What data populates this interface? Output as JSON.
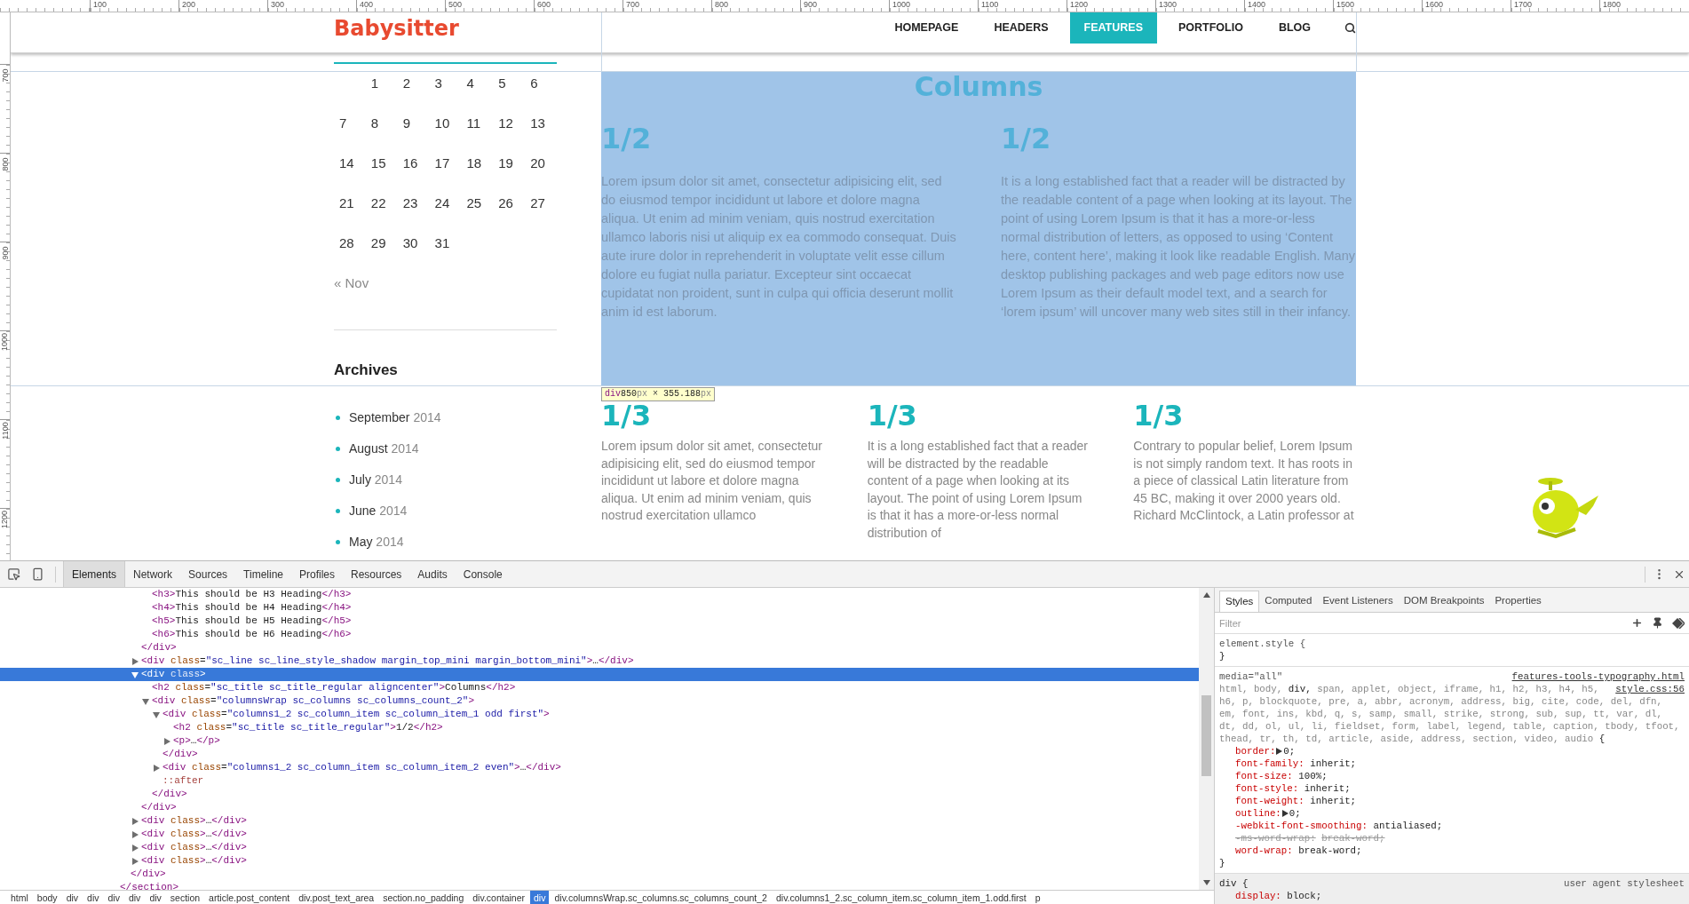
{
  "ruler": {
    "top_labels": [
      "100",
      "200",
      "300",
      "400",
      "500",
      "600",
      "700",
      "800",
      "900",
      "1000",
      "1100",
      "1200",
      "1300",
      "1400",
      "1500",
      "1600",
      "1700",
      "1800"
    ],
    "side_labels": [
      "700",
      "800",
      "900",
      "1000",
      "1100",
      "1200"
    ]
  },
  "header": {
    "logo": "Babysitter",
    "nav": [
      {
        "label": "HOMEPAGE",
        "selected": false
      },
      {
        "label": "HEADERS",
        "selected": false
      },
      {
        "label": "FEATURES",
        "selected": true
      },
      {
        "label": "PORTFOLIO",
        "selected": false
      },
      {
        "label": "BLOG",
        "selected": false
      }
    ]
  },
  "sidebar": {
    "calendar": {
      "weeks": [
        [
          "1",
          "2",
          "3",
          "4",
          "5",
          "6"
        ],
        [
          "7",
          "8",
          "9",
          "10",
          "11",
          "12",
          "13"
        ],
        [
          "14",
          "15",
          "16",
          "17",
          "18",
          "19",
          "20"
        ],
        [
          "21",
          "22",
          "23",
          "24",
          "25",
          "26",
          "27"
        ],
        [
          "28",
          "29",
          "30",
          "31"
        ]
      ],
      "prev_link": "« Nov"
    },
    "archives": {
      "title": "Archives",
      "items": [
        {
          "month": "September",
          "year": "2014"
        },
        {
          "month": "August",
          "year": "2014"
        },
        {
          "month": "July",
          "year": "2014"
        },
        {
          "month": "June",
          "year": "2014"
        },
        {
          "month": "May",
          "year": "2014"
        }
      ]
    }
  },
  "columns_block": {
    "title": "Columns",
    "highlighted": true,
    "columns": [
      {
        "heading": "1/2",
        "text": "Lorem ipsum dolor sit amet, consectetur adipisicing elit, sed do eiusmod tempor incididunt ut labore et dolore magna aliqua. Ut enim ad minim veniam, quis nostrud exercitation ullamco laboris nisi ut aliquip ex ea commodo consequat. Duis aute irure dolor in reprehenderit in voluptate velit esse cillum dolore eu fugiat nulla pariatur. Excepteur sint occaecat cupidatat non proident, sunt in culpa qui officia deserunt mollit anim id est laborum."
      },
      {
        "heading": "1/2",
        "text": "It is a long established fact that a reader will be distracted by the readable content of a page when looking at its layout. The point of using Lorem Ipsum is that it has a more-or-less normal distribution of letters, as opposed to using ‘Content here, content here’, making it look like readable English. Many desktop publishing packages and web page editors now use Lorem Ipsum as their default model text, and a search for ‘lorem ipsum’ will uncover many web sites still in their infancy."
      }
    ]
  },
  "size_tooltip": {
    "parts": [
      {
        "kind": "tag",
        "text": "div"
      },
      {
        "kind": "number",
        "text": "850"
      },
      {
        "kind": "unit",
        "text": "px"
      },
      {
        "kind": "text",
        "text": " × "
      },
      {
        "kind": "number",
        "text": "355.188"
      },
      {
        "kind": "unit",
        "text": "px"
      }
    ]
  },
  "thirds_block": {
    "columns": [
      {
        "heading": "1/3",
        "text": "Lorem ipsum dolor sit amet, consectetur adipisicing elit, sed do eiusmod tempor incididunt ut labore et dolore magna aliqua. Ut enim ad minim veniam, quis nostrud exercitation ullamco"
      },
      {
        "heading": "1/3",
        "text": "It is a long established fact that a reader will be distracted by the readable content of a page when looking at its layout. The point of using Lorem Ipsum is that it has a more-or-less normal distribution of"
      },
      {
        "heading": "1/3",
        "text": "Contrary to popular belief, Lorem Ipsum is not simply random text. It has roots in a piece of classical Latin literature from 45 BC, making it over 2000 years old. Richard McClintock, a Latin professor at"
      }
    ]
  },
  "devtools": {
    "tabs": [
      {
        "label": "Elements",
        "selected": true
      },
      {
        "label": "Network",
        "selected": false
      },
      {
        "label": "Sources",
        "selected": false
      },
      {
        "label": "Timeline",
        "selected": false
      },
      {
        "label": "Profiles",
        "selected": false
      },
      {
        "label": "Resources",
        "selected": false
      },
      {
        "label": "Audits",
        "selected": false
      },
      {
        "label": "Console",
        "selected": false
      }
    ],
    "tree": [
      {
        "selected": false,
        "close": [
          {
            "kind": "tag",
            "text": "</section>"
          }
        ],
        "children": [
          {
            "selected": false,
            "close": [
              {
                "kind": "tag",
                "text": "</div>"
              }
            ],
            "children": [
              {
                "selected": false,
                "close": [
                  {
                    "kind": "tag",
                    "text": "</div>"
                  }
                ],
                "children": [
                  {
                    "selected": false,
                    "open": [
                      {
                        "kind": "tag",
                        "text": "<h3>"
                      },
                      {
                        "kind": "text",
                        "text": "This should be H3 Heading"
                      },
                      {
                        "kind": "tag",
                        "text": "</h3>"
                      }
                    ]
                  },
                  {
                    "selected": false,
                    "open": [
                      {
                        "kind": "tag",
                        "text": "<h4>"
                      },
                      {
                        "kind": "text",
                        "text": "This should be H4 Heading"
                      },
                      {
                        "kind": "tag",
                        "text": "</h4>"
                      }
                    ]
                  },
                  {
                    "selected": false,
                    "open": [
                      {
                        "kind": "tag",
                        "text": "<h5>"
                      },
                      {
                        "kind": "text",
                        "text": "This should be H5 Heading"
                      },
                      {
                        "kind": "tag",
                        "text": "</h5>"
                      }
                    ]
                  },
                  {
                    "selected": false,
                    "open": [
                      {
                        "kind": "tag",
                        "text": "<h6>"
                      },
                      {
                        "kind": "text",
                        "text": "This should be H6 Heading"
                      },
                      {
                        "kind": "tag",
                        "text": "</h6>"
                      }
                    ]
                  }
                ]
              },
              {
                "selected": false,
                "expanded": false,
                "open": [
                  {
                    "kind": "tag",
                    "text": "<div"
                  },
                  {
                    "kind": "attr",
                    "text": " class"
                  },
                  {
                    "kind": "text",
                    "text": "="
                  },
                  {
                    "kind": "value",
                    "text": "\"sc_line sc_line_style_shadow margin_top_mini margin_bottom_mini\""
                  },
                  {
                    "kind": "tag",
                    "text": ">"
                  },
                  {
                    "kind": "text",
                    "text": "…"
                  },
                  {
                    "kind": "tag",
                    "text": "</div>"
                  }
                ]
              },
              {
                "selected": true,
                "expanded": true,
                "open": [
                  {
                    "kind": "tag",
                    "text": "<div"
                  },
                  {
                    "kind": "attr",
                    "text": " class"
                  },
                  {
                    "kind": "tag",
                    "text": ">"
                  }
                ],
                "close": [
                  {
                    "kind": "tag",
                    "text": "</div>"
                  }
                ],
                "children": [
                  {
                    "selected": false,
                    "open": [
                      {
                        "kind": "tag",
                        "text": "<h2"
                      },
                      {
                        "kind": "attr",
                        "text": " class"
                      },
                      {
                        "kind": "text",
                        "text": "="
                      },
                      {
                        "kind": "value",
                        "text": "\"sc_title sc_title_regular aligncenter\""
                      },
                      {
                        "kind": "tag",
                        "text": ">"
                      },
                      {
                        "kind": "text",
                        "text": "Columns"
                      },
                      {
                        "kind": "tag",
                        "text": "</h2>"
                      }
                    ]
                  },
                  {
                    "selected": false,
                    "expanded": true,
                    "open": [
                      {
                        "kind": "tag",
                        "text": "<div"
                      },
                      {
                        "kind": "attr",
                        "text": " class"
                      },
                      {
                        "kind": "text",
                        "text": "="
                      },
                      {
                        "kind": "value",
                        "text": "\"columnsWrap sc_columns sc_columns_count_2\""
                      },
                      {
                        "kind": "tag",
                        "text": ">"
                      }
                    ],
                    "close": [
                      {
                        "kind": "tag",
                        "text": "</div>"
                      }
                    ],
                    "children": [
                      {
                        "selected": false,
                        "expanded": true,
                        "open": [
                          {
                            "kind": "tag",
                            "text": "<div"
                          },
                          {
                            "kind": "attr",
                            "text": " class"
                          },
                          {
                            "kind": "text",
                            "text": "="
                          },
                          {
                            "kind": "value",
                            "text": "\"columns1_2 sc_column_item sc_column_item_1 odd first\""
                          },
                          {
                            "kind": "tag",
                            "text": ">"
                          }
                        ],
                        "close": [
                          {
                            "kind": "tag",
                            "text": "</div>"
                          }
                        ],
                        "children": [
                          {
                            "selected": false,
                            "open": [
                              {
                                "kind": "tag",
                                "text": "<h2"
                              },
                              {
                                "kind": "attr",
                                "text": " class"
                              },
                              {
                                "kind": "text",
                                "text": "="
                              },
                              {
                                "kind": "value",
                                "text": "\"sc_title sc_title_regular\""
                              },
                              {
                                "kind": "tag",
                                "text": ">"
                              },
                              {
                                "kind": "text",
                                "text": "1/2"
                              },
                              {
                                "kind": "tag",
                                "text": "</h2>"
                              }
                            ]
                          },
                          {
                            "selected": false,
                            "expanded": false,
                            "open": [
                              {
                                "kind": "tag",
                                "text": "<p>"
                              },
                              {
                                "kind": "text",
                                "text": "…"
                              },
                              {
                                "kind": "tag",
                                "text": "</p>"
                              }
                            ]
                          }
                        ]
                      },
                      {
                        "selected": false,
                        "expanded": false,
                        "open": [
                          {
                            "kind": "tag",
                            "text": "<div"
                          },
                          {
                            "kind": "attr",
                            "text": " class"
                          },
                          {
                            "kind": "text",
                            "text": "="
                          },
                          {
                            "kind": "value",
                            "text": "\"columns1_2 sc_column_item sc_column_item_2 even\""
                          },
                          {
                            "kind": "tag",
                            "text": ">"
                          },
                          {
                            "kind": "text",
                            "text": "…"
                          },
                          {
                            "kind": "tag",
                            "text": "</div>"
                          }
                        ]
                      },
                      {
                        "selected": false,
                        "open": [
                          {
                            "kind": "pseudo",
                            "text": "::after"
                          }
                        ]
                      }
                    ]
                  }
                ]
              },
              {
                "selected": false,
                "expanded": false,
                "open": [
                  {
                    "kind": "tag",
                    "text": "<div"
                  },
                  {
                    "kind": "attr",
                    "text": " class"
                  },
                  {
                    "kind": "tag",
                    "text": ">"
                  },
                  {
                    "kind": "text",
                    "text": "…"
                  },
                  {
                    "kind": "tag",
                    "text": "</div>"
                  }
                ]
              },
              {
                "selected": false,
                "expanded": false,
                "open": [
                  {
                    "kind": "tag",
                    "text": "<div"
                  },
                  {
                    "kind": "attr",
                    "text": " class"
                  },
                  {
                    "kind": "tag",
                    "text": ">"
                  },
                  {
                    "kind": "text",
                    "text": "…"
                  },
                  {
                    "kind": "tag",
                    "text": "</div>"
                  }
                ]
              },
              {
                "selected": false,
                "expanded": false,
                "open": [
                  {
                    "kind": "tag",
                    "text": "<div"
                  },
                  {
                    "kind": "attr",
                    "text": " class"
                  },
                  {
                    "kind": "tag",
                    "text": ">"
                  },
                  {
                    "kind": "text",
                    "text": "…"
                  },
                  {
                    "kind": "tag",
                    "text": "</div>"
                  }
                ]
              },
              {
                "selected": false,
                "expanded": false,
                "open": [
                  {
                    "kind": "tag",
                    "text": "<div"
                  },
                  {
                    "kind": "attr",
                    "text": " class"
                  },
                  {
                    "kind": "tag",
                    "text": ">"
                  },
                  {
                    "kind": "text",
                    "text": "…"
                  },
                  {
                    "kind": "tag",
                    "text": "</div>"
                  }
                ]
              }
            ]
          }
        ]
      }
    ],
    "breadcrumbs": [
      {
        "label": "html",
        "selected": false
      },
      {
        "label": "body",
        "selected": false
      },
      {
        "label": "div",
        "selected": false
      },
      {
        "label": "div",
        "selected": false
      },
      {
        "label": "div",
        "selected": false
      },
      {
        "label": "div",
        "selected": false
      },
      {
        "label": "div",
        "selected": false
      },
      {
        "label": "section",
        "selected": false
      },
      {
        "label": "article.post_content",
        "selected": false
      },
      {
        "label": "div.post_text_area",
        "selected": false
      },
      {
        "label": "section.no_padding",
        "selected": false
      },
      {
        "label": "div.container",
        "selected": false
      },
      {
        "label": "div",
        "selected": true
      },
      {
        "label": "div.columnsWrap.sc_columns.sc_columns_count_2",
        "selected": false
      },
      {
        "label": "div.columns1_2.sc_column_item.sc_column_item_1.odd.first",
        "selected": false
      },
      {
        "label": "p",
        "selected": false
      }
    ],
    "styles": {
      "tabs": [
        {
          "label": "Styles",
          "selected": true
        },
        {
          "label": "Computed",
          "selected": false
        },
        {
          "label": "Event Listeners",
          "selected": false
        },
        {
          "label": "DOM Breakpoints",
          "selected": false
        },
        {
          "label": "Properties",
          "selected": false
        }
      ],
      "filter_placeholder": "Filter",
      "element_style": {
        "selector": "element.style",
        "open": "{",
        "close": "}"
      },
      "rules": [
        {
          "user_agent": false,
          "media": "media=\"all\"",
          "source": "features-tools-typography.html",
          "source_line": "style.css:56",
          "open": "{",
          "close": "}",
          "selectors": [
            {
              "text": "html,",
              "matched": false
            },
            {
              "text": "body,",
              "matched": false
            },
            {
              "text": "div,",
              "matched": true
            },
            {
              "text": "span,",
              "matched": false
            },
            {
              "text": "applet,",
              "matched": false
            },
            {
              "text": "object,",
              "matched": false
            },
            {
              "text": "iframe,",
              "matched": false
            },
            {
              "text": "h1,",
              "matched": false
            },
            {
              "text": "h2,",
              "matched": false
            },
            {
              "text": "h3,",
              "matched": false
            },
            {
              "text": "h4,",
              "matched": false
            },
            {
              "text": "h5,",
              "matched": false
            },
            {
              "text": "h6,",
              "matched": false
            },
            {
              "text": "p,",
              "matched": false
            },
            {
              "text": "blockquote,",
              "matched": false
            },
            {
              "text": "pre,",
              "matched": false
            },
            {
              "text": "a,",
              "matched": false
            },
            {
              "text": "abbr,",
              "matched": false
            },
            {
              "text": "acronym,",
              "matched": false
            },
            {
              "text": "address,",
              "matched": false
            },
            {
              "text": "big,",
              "matched": false
            },
            {
              "text": "cite,",
              "matched": false
            },
            {
              "text": "code,",
              "matched": false
            },
            {
              "text": "del,",
              "matched": false
            },
            {
              "text": "dfn,",
              "matched": false
            },
            {
              "text": "em,",
              "matched": false
            },
            {
              "text": "font,",
              "matched": false
            },
            {
              "text": "ins,",
              "matched": false
            },
            {
              "text": "kbd,",
              "matched": false
            },
            {
              "text": "q,",
              "matched": false
            },
            {
              "text": "s,",
              "matched": false
            },
            {
              "text": "samp,",
              "matched": false
            },
            {
              "text": "small,",
              "matched": false
            },
            {
              "text": "strike,",
              "matched": false
            },
            {
              "text": "strong,",
              "matched": false
            },
            {
              "text": "sub,",
              "matched": false
            },
            {
              "text": "sup,",
              "matched": false
            },
            {
              "text": "tt,",
              "matched": false
            },
            {
              "text": "var,",
              "matched": false
            },
            {
              "text": "dl,",
              "matched": false
            },
            {
              "text": "dt,",
              "matched": false
            },
            {
              "text": "dd,",
              "matched": false
            },
            {
              "text": "ol,",
              "matched": false
            },
            {
              "text": "ul,",
              "matched": false
            },
            {
              "text": "li,",
              "matched": false
            },
            {
              "text": "fieldset,",
              "matched": false
            },
            {
              "text": "form,",
              "matched": false
            },
            {
              "text": "label,",
              "matched": false
            },
            {
              "text": "legend,",
              "matched": false
            },
            {
              "text": "table,",
              "matched": false
            },
            {
              "text": "caption,",
              "matched": false
            },
            {
              "text": "tbody,",
              "matched": false
            },
            {
              "text": "tfoot,",
              "matched": false
            },
            {
              "text": "thead,",
              "matched": false
            },
            {
              "text": "tr,",
              "matched": false
            },
            {
              "text": "th,",
              "matched": false
            },
            {
              "text": "td,",
              "matched": false
            },
            {
              "text": "article,",
              "matched": false
            },
            {
              "text": "aside,",
              "matched": false
            },
            {
              "text": "address,",
              "matched": false
            },
            {
              "text": "section,",
              "matched": false
            },
            {
              "text": "video,",
              "matched": false
            },
            {
              "text": "audio",
              "matched": false
            }
          ],
          "properties": [
            {
              "name": "border:",
              "value": "0;",
              "expandable": true,
              "overridden": false
            },
            {
              "name": "font-family:",
              "value": "inherit;",
              "expandable": false,
              "overridden": false
            },
            {
              "name": "font-size:",
              "value": "100%;",
              "expandable": false,
              "overridden": false
            },
            {
              "name": "font-style:",
              "value": "inherit;",
              "expandable": false,
              "overridden": false
            },
            {
              "name": "font-weight:",
              "value": "inherit;",
              "expandable": false,
              "overridden": false
            },
            {
              "name": "outline:",
              "value": "0;",
              "expandable": true,
              "overridden": false
            },
            {
              "name": "-webkit-font-smoothing:",
              "value": "antialiased;",
              "expandable": false,
              "overridden": false
            },
            {
              "name": "-ms-word-wrap:",
              "value": "break-word;",
              "expandable": false,
              "overridden": true
            },
            {
              "name": "word-wrap:",
              "value": "break-word;",
              "expandable": false,
              "overridden": false
            }
          ]
        },
        {
          "user_agent": true,
          "origin": "user agent stylesheet",
          "open": "{",
          "selectors": [
            {
              "text": "div",
              "matched": true
            }
          ],
          "properties": [
            {
              "name": "display:",
              "value": "block;",
              "expandable": false,
              "overridden": false
            }
          ]
        }
      ]
    }
  }
}
